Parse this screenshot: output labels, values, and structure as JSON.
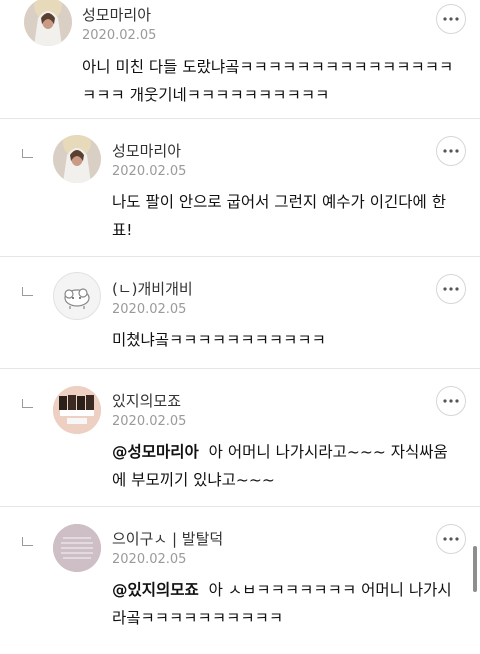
{
  "comments": [
    {
      "nickname": "성모마리아",
      "date": "2020.02.05",
      "mention": "",
      "text": "아니 미친 다들 도랐냐곸ㅋㅋㅋㅋㅋㅋㅋㅋㅋㅋㅋㅋㅋㅋㅋㅋㅋㅋ 개웃기네ㅋㅋㅋㅋㅋㅋㅋㅋㅋㅋ",
      "avatar_icon": "virgin-mary-avatar",
      "is_reply": false
    },
    {
      "nickname": "성모마리아",
      "date": "2020.02.05",
      "mention": "",
      "text": "나도 팔이 안으로 굽어서 그런지 예수가 이긴다에 한표!",
      "avatar_icon": "virgin-mary-avatar",
      "is_reply": true
    },
    {
      "nickname": "(ㄴ)개비개비",
      "date": "2020.02.05",
      "mention": "",
      "text": "미쳤냐곸ㅋㅋㅋㅋㅋㅋㅋㅋㅋㅋㅋ",
      "avatar_icon": "cartoon-sheep-avatar",
      "is_reply": true
    },
    {
      "nickname": "있지의모죠",
      "date": "2020.02.05",
      "mention": "@성모마리아",
      "text": "아 어머니 나가시라고~~~ 자식싸움에 부모끼기 있냐고~~~",
      "avatar_icon": "group-photo-avatar",
      "is_reply": true
    },
    {
      "nickname": "으이구ㅅ | 발탈덕",
      "date": "2020.02.05",
      "mention": "@있지의모죠",
      "text": "아 ㅅㅂㅋㅋㅋㅋㅋㅋㅋ 어머니 나가시라곸ㅋㅋㅋㅋㅋㅋㅋㅋㅋㅋ",
      "avatar_icon": "text-image-avatar",
      "is_reply": true
    }
  ],
  "colors": {
    "date": "#9a9a9a",
    "divider": "#e6e6e6",
    "scrollbar": "#8e8e8e"
  }
}
